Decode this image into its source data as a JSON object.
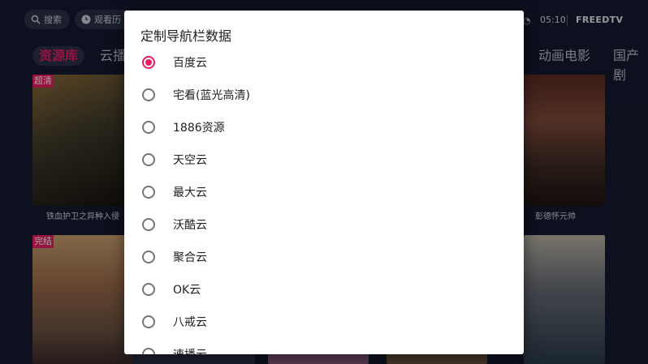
{
  "topbar": {
    "search_label": "搜索",
    "history_label": "观看历",
    "time": "05:10",
    "brand": "FREEDTV"
  },
  "tabs": [
    {
      "label": "资源库",
      "active": true
    },
    {
      "label": "云播",
      "active": false
    },
    {
      "label": "动画电影",
      "active": false
    },
    {
      "label": "国产剧",
      "active": false
    }
  ],
  "posters": [
    {
      "title": "铁血护卫之异种入侵",
      "badge": "超清"
    },
    {
      "title": "彭德怀元帅",
      "badge": ""
    },
    {
      "title": "",
      "badge": "完结"
    },
    {
      "title": "",
      "badge": ""
    }
  ],
  "dialog": {
    "title": "定制导航栏数据",
    "options": [
      {
        "label": "百度云",
        "selected": true
      },
      {
        "label": "宅看(蓝光高清)",
        "selected": false
      },
      {
        "label": "1886资源",
        "selected": false
      },
      {
        "label": "天空云",
        "selected": false
      },
      {
        "label": "最大云",
        "selected": false
      },
      {
        "label": "沃酷云",
        "selected": false
      },
      {
        "label": "聚合云",
        "selected": false
      },
      {
        "label": "OK云",
        "selected": false
      },
      {
        "label": "八戒云",
        "selected": false
      },
      {
        "label": "速播云",
        "selected": false
      }
    ]
  },
  "colors": {
    "accent": "#e91e63",
    "background": "#141a2e"
  }
}
